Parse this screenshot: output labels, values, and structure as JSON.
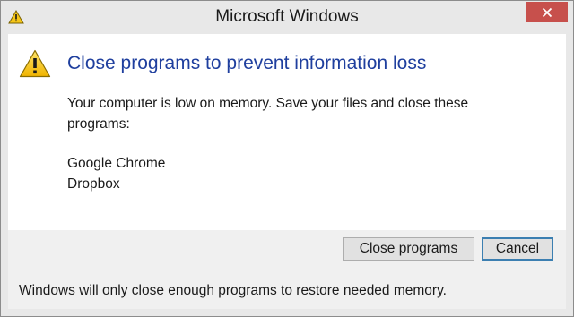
{
  "window": {
    "title": "Microsoft Windows",
    "title_icon": "warning-icon",
    "close_icon": "close-icon",
    "close_color": "#c7504c"
  },
  "dialog": {
    "icon": "warning-icon",
    "heading": "Close programs to prevent information loss",
    "message": "Your computer is low on memory. Save your files and close these programs:",
    "programs": [
      "Google Chrome",
      "Dropbox"
    ],
    "heading_color": "#1f3f9e"
  },
  "buttons": {
    "close_programs": "Close programs",
    "cancel": "Cancel"
  },
  "footer": {
    "note": "Windows will only close enough programs to restore needed memory."
  }
}
